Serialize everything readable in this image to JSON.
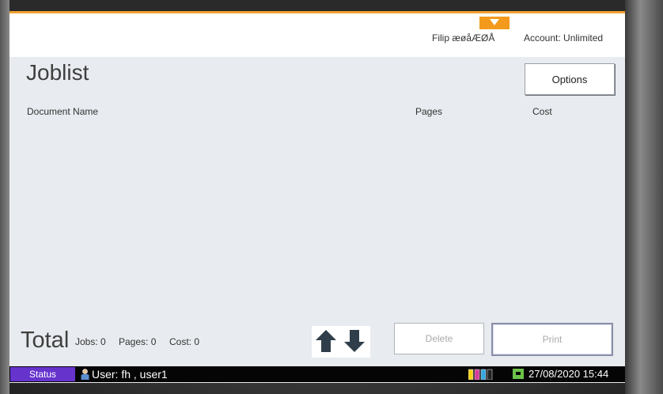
{
  "header": {
    "user_name": "Filip æøåÆØÅ",
    "account": "Account: Unlimited"
  },
  "joblist": {
    "title": "Joblist",
    "options_label": "Options",
    "columns": {
      "document_name": "Document Name",
      "pages": "Pages",
      "cost": "Cost"
    }
  },
  "totals": {
    "label": "Total",
    "jobs_label": "Jobs:",
    "jobs_value": "0",
    "pages_label": "Pages:",
    "pages_value": "0",
    "cost_label": "Cost:",
    "cost_value": "0"
  },
  "actions": {
    "delete_label": "Delete",
    "print_label": "Print"
  },
  "statusbar": {
    "status_label": "Status",
    "user_label": "User: fh , user1",
    "datetime": "27/08/2020 15:44"
  },
  "colors": {
    "accent_orange": "#f39a1d",
    "status_purple": "#6633cc",
    "network_green": "#6cc24a",
    "screen_bg": "#e8ebef"
  },
  "icons": {
    "user_menu": "dropdown-triangle-icon",
    "scroll_up": "arrow-up-icon",
    "scroll_down": "arrow-down-icon",
    "user": "person-icon",
    "ink": "toner-cartridges-icon",
    "network": "network-icon"
  }
}
